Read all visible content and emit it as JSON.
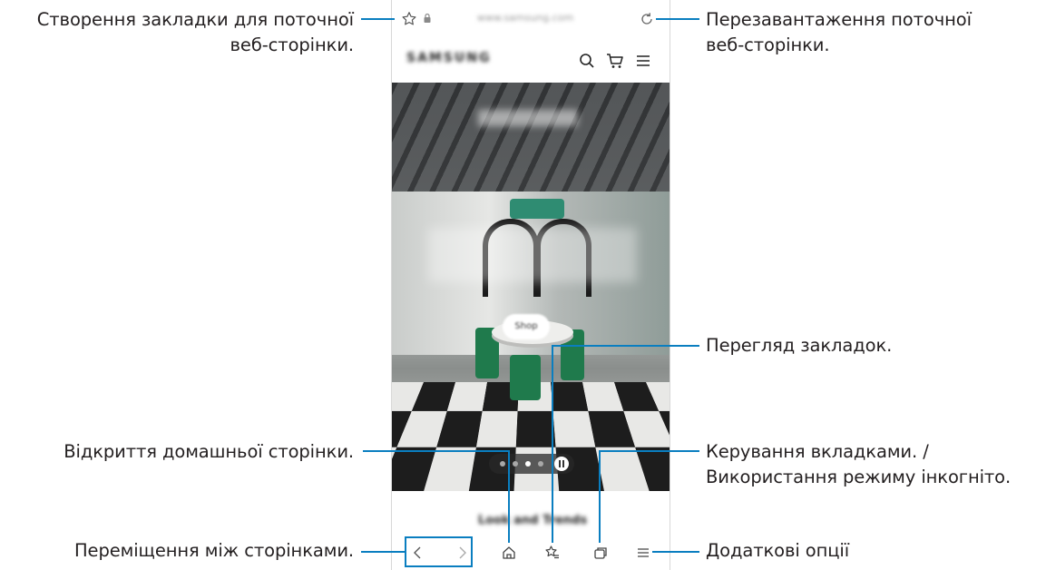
{
  "browser": {
    "url": "www.samsung.com",
    "site_brand": "SAMSUNG",
    "hero_button": "Shop",
    "section_title": "Look and Trends",
    "icons": {
      "bookmark_add": "star-icon",
      "lock": "lock-icon",
      "reload": "reload-icon",
      "search": "search-icon",
      "cart": "cart-icon",
      "menu": "hamburger-icon",
      "back": "chevron-left-icon",
      "forward": "chevron-right-icon",
      "home": "home-icon",
      "bookmarks": "bookmarks-icon",
      "tabs": "tabs-icon",
      "more": "more-options-icon"
    }
  },
  "callouts": {
    "bookmark_add": [
      "Створення закладки для поточної",
      "веб-сторінки."
    ],
    "reload": [
      "Перезавантаження поточної",
      "веб-сторінки."
    ],
    "bookmarks": "Перегляд закладок.",
    "home": "Відкриття домашньої сторінки.",
    "tabs": [
      "Керування вкладками. /",
      "Використання режиму інкогніто."
    ],
    "navigation": "Переміщення між сторінками.",
    "more": "Додаткові опції"
  },
  "colors": {
    "leader_line": "#0a7ec0",
    "text": "#231f20"
  }
}
